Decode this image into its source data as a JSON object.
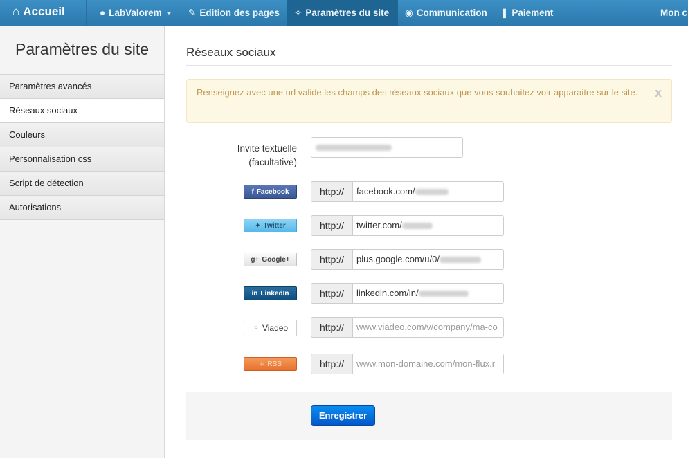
{
  "nav": {
    "brand": "Accueil",
    "items": [
      {
        "label": "LabValorem"
      },
      {
        "label": "Edition des pages"
      },
      {
        "label": "Paramètres du site"
      },
      {
        "label": "Communication"
      },
      {
        "label": "Paiement"
      },
      {
        "label": "Mon c"
      }
    ],
    "colors": {
      "bar": "#2b79ad",
      "active": "#1f6594"
    }
  },
  "sidebar": {
    "title": "Paramètres du site",
    "items": [
      {
        "label": "Paramètres avancés"
      },
      {
        "label": "Réseaux sociaux"
      },
      {
        "label": "Couleurs"
      },
      {
        "label": "Personnalisation css"
      },
      {
        "label": "Script de détection"
      },
      {
        "label": "Autorisations"
      }
    ],
    "active_index": 1
  },
  "main": {
    "title": "Réseaux sociaux",
    "alert": {
      "text": "Renseignez avec une url valide les champs des réseaux sociaux que vous souhaitez voir apparaitre sur le site.",
      "close": "x"
    },
    "invite": {
      "label": "Invite textuelle (facultative)"
    },
    "prefix": "http://",
    "networks": [
      {
        "badge": "Facebook",
        "value": "facebook.com/",
        "placeholder": ""
      },
      {
        "badge": "Twitter",
        "value": "twitter.com/",
        "placeholder": ""
      },
      {
        "badge": "Google+",
        "value": "plus.google.com/u/0/",
        "placeholder": ""
      },
      {
        "badge": "LinkedIn",
        "value": "linkedin.com/in/",
        "placeholder": ""
      },
      {
        "badge": "Viadeo",
        "value": "",
        "placeholder": "www.viadeo.com/v/company/ma-co"
      },
      {
        "badge": "RSS",
        "value": "",
        "placeholder": "www.mon-domaine.com/mon-flux.r"
      }
    ],
    "save_label": "Enregistrer"
  }
}
